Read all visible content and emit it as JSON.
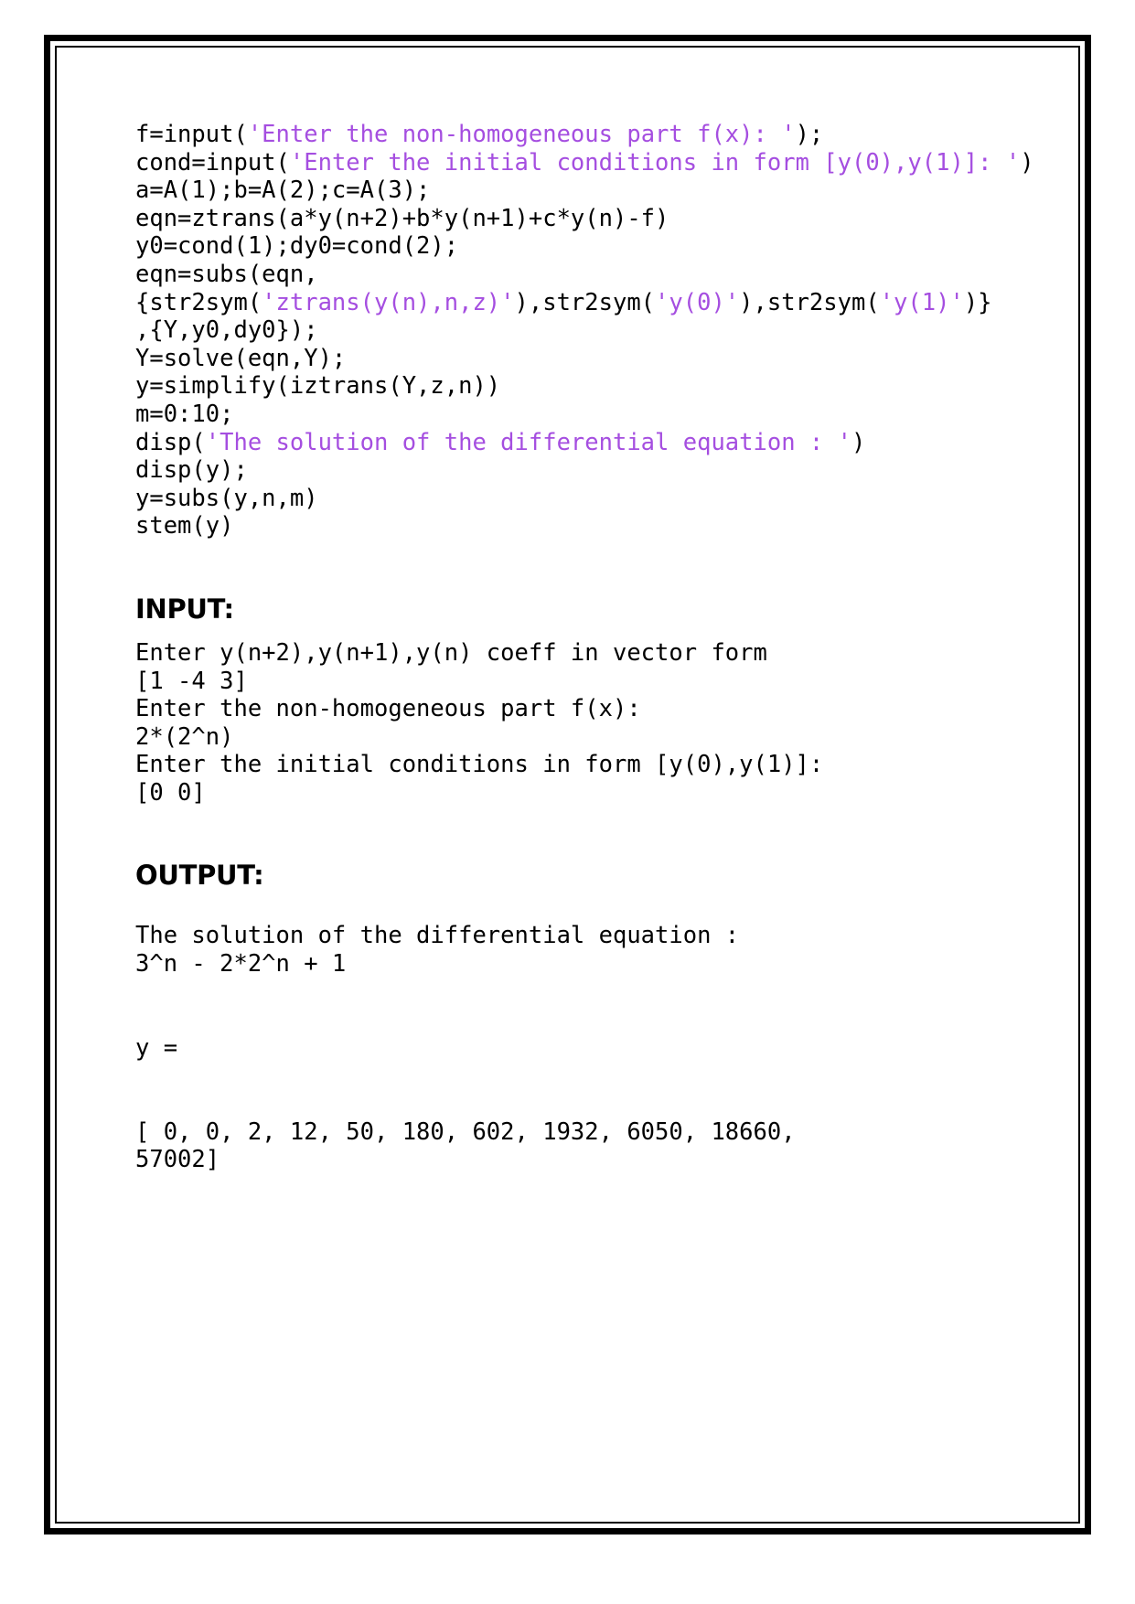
{
  "document": {
    "type": "matlab-lab-record-page",
    "border_color": "#000000",
    "string_literal_color": "#a54ee0",
    "text_color": "#000000",
    "background_color": "#ffffff"
  },
  "code": {
    "lines": [
      [
        {
          "t": "f=input(",
          "k": "plain"
        },
        {
          "t": "'Enter the non-homogeneous part f(x): '",
          "k": "string"
        },
        {
          "t": ");",
          "k": "plain"
        }
      ],
      [
        {
          "t": "cond=input(",
          "k": "plain"
        },
        {
          "t": "'Enter the initial conditions in form [y(0),y(1)]: '",
          "k": "string"
        },
        {
          "t": ")",
          "k": "plain"
        }
      ],
      [
        {
          "t": "a=A(1);b=A(2);c=A(3);",
          "k": "plain"
        }
      ],
      [
        {
          "t": "eqn=ztrans(a*y(n+2)+b*y(n+1)+c*y(n)-f)",
          "k": "plain"
        }
      ],
      [
        {
          "t": "y0=cond(1);dy0=cond(2);",
          "k": "plain"
        }
      ],
      [
        {
          "t": "eqn=subs(eqn,",
          "k": "plain"
        }
      ],
      [
        {
          "t": "{str2sym(",
          "k": "plain"
        },
        {
          "t": "'ztrans(y(n),n,z)'",
          "k": "string"
        },
        {
          "t": "),str2sym(",
          "k": "plain"
        },
        {
          "t": "'y(0)'",
          "k": "string"
        },
        {
          "t": "),str2sym(",
          "k": "plain"
        },
        {
          "t": "'y(1)'",
          "k": "string"
        },
        {
          "t": ")}",
          "k": "plain"
        }
      ],
      [
        {
          "t": ",{Y,y0,dy0});",
          "k": "plain"
        }
      ],
      [
        {
          "t": "Y=solve(eqn,Y);",
          "k": "plain"
        }
      ],
      [
        {
          "t": "y=simplify(iztrans(Y,z,n))",
          "k": "plain"
        }
      ],
      [
        {
          "t": "m=0:10;",
          "k": "plain"
        }
      ],
      [
        {
          "t": "disp(",
          "k": "plain"
        },
        {
          "t": "'The solution of the differential equation : '",
          "k": "string"
        },
        {
          "t": ")",
          "k": "plain"
        }
      ],
      [
        {
          "t": "disp(y);",
          "k": "plain"
        }
      ],
      [
        {
          "t": "y=subs(y,n,m)",
          "k": "plain"
        }
      ],
      [
        {
          "t": "stem(y)",
          "k": "plain"
        }
      ]
    ]
  },
  "input_section": {
    "heading": "INPUT:",
    "lines": [
      "Enter y(n+2),y(n+1),y(n) coeff in vector form",
      "[1 -4 3]",
      "Enter the non-homogeneous part f(x):",
      "2*(2^n)",
      "Enter the initial conditions in form [y(0),y(1)]:",
      "[0 0]"
    ]
  },
  "output_section": {
    "heading": "OUTPUT:",
    "solution_label": "The solution of the differential equation :",
    "solution_expression": "3^n - 2*2^n + 1",
    "variable_label": "y =",
    "values_line_1": "[ 0, 0, 2, 12, 50, 180, 602, 1932, 6050, 18660,",
    "values_line_2": "57002]",
    "values": [
      0,
      0,
      2,
      12,
      50,
      180,
      602,
      1932,
      6050,
      18660,
      57002
    ]
  }
}
